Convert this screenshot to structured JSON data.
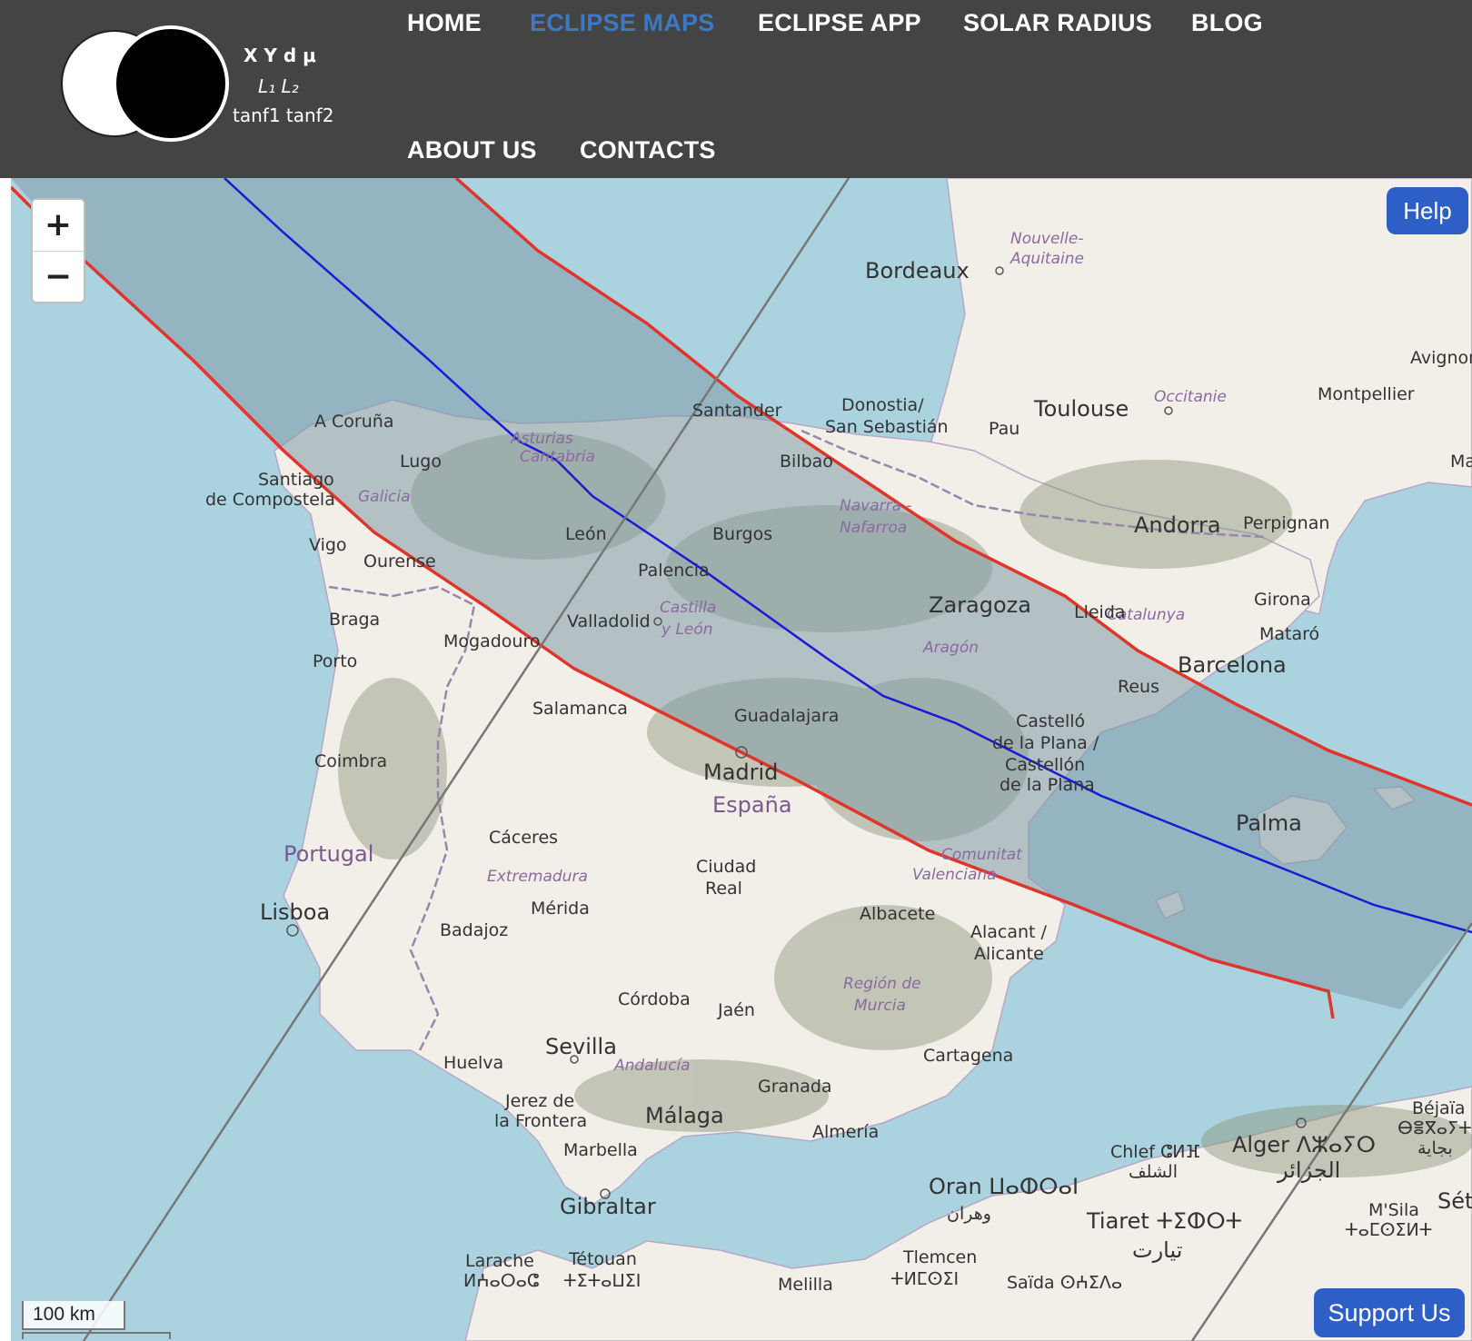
{
  "logo": {
    "glyphs": [
      "X  Y  d  μ",
      "L₁  L₂",
      "tanf1  tanf2"
    ]
  },
  "nav": {
    "items": [
      {
        "label": "HOME",
        "active": false
      },
      {
        "label": "ECLIPSE MAPS",
        "active": true
      },
      {
        "label": "ECLIPSE APP",
        "active": false
      },
      {
        "label": "SOLAR RADIUS",
        "active": false
      },
      {
        "label": "BLOG",
        "active": false
      },
      {
        "label": "ABOUT US",
        "active": false
      },
      {
        "label": "CONTACTS",
        "active": false
      }
    ],
    "active_color": "#3b78c6"
  },
  "map": {
    "controls": {
      "zoom_in": "+",
      "zoom_out": "−",
      "help": "Help",
      "support": "Support Us"
    },
    "scale": "100 km",
    "colors": {
      "path_limit": "#e0352b",
      "central_line": "#1a1ad6",
      "shadow_band": "#7f9aa6",
      "sea": "#aad3df",
      "land": "#f2efe9"
    },
    "countries": [
      "Portugal",
      "España"
    ],
    "regions": [
      "Nouvelle-",
      "Aquitaine",
      "Occitanie",
      "Asturias",
      "Cantabria",
      "Galicia",
      "Navarra -",
      "Nafarroa",
      "Castilla",
      "y León",
      "Aragón",
      "Catalunya",
      "Extremadura",
      "Comunitat",
      "Valenciana",
      "Región de",
      "Murcia",
      "Andalucía"
    ],
    "cities": {
      "bordeaux": "Bordeaux",
      "toulouse": "Toulouse",
      "pau": "Pau",
      "montpellier": "Montpellier",
      "avignon": "Avignon",
      "ma": "Ma",
      "santander": "Santander",
      "donostia1": "Donostia/",
      "donostia2": "San Sebastián",
      "bilbao": "Bilbao",
      "acoruna": "A Coruña",
      "lugo": "Lugo",
      "santiago1": "Santiago",
      "santiago2": "de Compostela",
      "vigo": "Vigo",
      "ourense": "Ourense",
      "leon": "León",
      "burgos": "Burgos",
      "palencia": "Palencia",
      "andorra": "Andorra",
      "perpignan": "Perpignan",
      "zaragoza": "Zaragoza",
      "lleida": "Lleida",
      "girona": "Girona",
      "mataro": "Mataró",
      "barcelona": "Barcelona",
      "reus": "Reus",
      "braga": "Braga",
      "porto": "Porto",
      "mogadouro": "Mogadouro",
      "valladolid": "Valladolid",
      "salamanca": "Salamanca",
      "guadalajara": "Guadalajara",
      "castello1": "Castelló",
      "castello2": "de la Plana /",
      "castello3": "Castellón",
      "castello4": "de la Plana",
      "coimbra": "Coimbra",
      "madrid": "Madrid",
      "palma": "Palma",
      "caceres": "Cáceres",
      "ciudadreal1": "Ciudad",
      "ciudadreal2": "Real",
      "lisboa": "Lisboa",
      "merida": "Mérida",
      "badajoz": "Badajoz",
      "albacete": "Albacete",
      "alacant1": "Alacant /",
      "alacant2": "Alicante",
      "cordoba": "Córdoba",
      "jaen": "Jaén",
      "sevilla": "Sevilla",
      "huelva": "Huelva",
      "cartagena": "Cartagena",
      "granada": "Granada",
      "jerez1": "Jerez de",
      "jerez2": "la Frontera",
      "malaga": "Málaga",
      "almeria": "Almería",
      "marbella": "Marbella",
      "gibraltar": "Gibraltar",
      "bejaia1": "Béjaïa",
      "bejaia2": "ⴱⴻⴳⴰⵢⵜ",
      "bejaia3": "بجاية",
      "chlef1": "Chlef ⵛⵍⴼ",
      "chlef2": "الشلف",
      "alger1": "Alger ⴷⵣⴰⵢⵔ",
      "alger2": "الجزائر",
      "oran1": "Oran ⵡⴰⵀⵔⴰⵏ",
      "oran2": "وهران",
      "tiaret1": "Tiaret ⵜⵉⵀⵔⵜ",
      "tiaret2": "تيارت",
      "msila1": "M'Sila",
      "msila2": "ⵜⴰⵎⵙⵉⵍⵜ",
      "set": "Sét",
      "larache1": "Larache",
      "larache2": "ⵍⵄⴰⵔⴰⵛ",
      "tetouan1": "Tétouan",
      "tetouan2": "ⵜⵉⵜⴰⵡⵉⵏ",
      "melilla": "Melilla",
      "tlemcen1": "Tlemcen",
      "tlemcen2": "ⵜⵍⵎⵙⵉⵏ",
      "saida": "Saïda ⵙⵄⵉⴷⴰ"
    }
  }
}
